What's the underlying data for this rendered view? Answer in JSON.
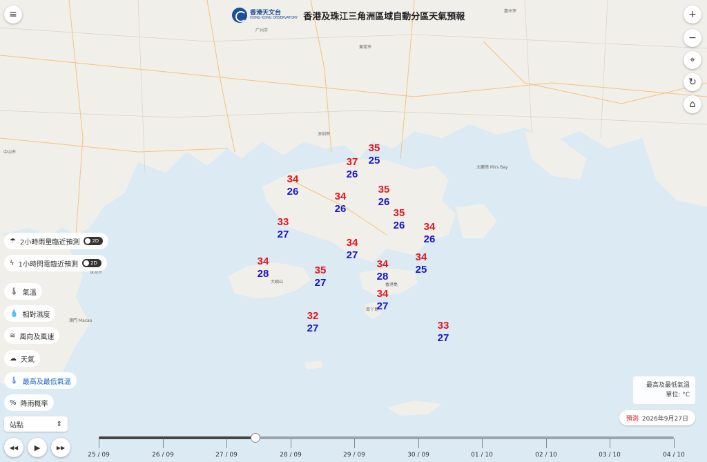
{
  "header": {
    "logo_cn": "香港天文台",
    "logo_en": "HONG KONG OBSERVATORY",
    "title": "香港及珠江三角洲區域自動分區天氣預報"
  },
  "controls": {
    "menu_icon": "≡",
    "zoom_in": "+",
    "zoom_out": "−",
    "locate_icon": "⌖",
    "refresh_icon": "↻",
    "home_icon": "⌂"
  },
  "layers": [
    {
      "label": "2小時雨量臨近預測",
      "icon": "☂",
      "toggle": "2D"
    },
    {
      "label": "1小時閃電臨近預測",
      "icon": "ϟ",
      "toggle": "2D"
    },
    {
      "label": "氣溫",
      "icon": "🌡"
    },
    {
      "label": "相對濕度",
      "icon": "💧"
    },
    {
      "label": "風向及風速",
      "icon": "≋"
    },
    {
      "label": "天氣",
      "icon": "☁"
    },
    {
      "label": "最高及最低氣溫",
      "icon": "🌡",
      "active": true
    },
    {
      "label": "降雨概率",
      "icon": "%"
    }
  ],
  "station_select": {
    "value": "站點",
    "arrow": "⇕"
  },
  "playback": {
    "prev": "◀◀",
    "play": "▶",
    "next": "▶▶"
  },
  "legend": {
    "line1": "最高及最低氣溫",
    "line2": "單位: °C"
  },
  "forecast": {
    "label": "預測",
    "date": "2026年9月27日"
  },
  "timeline": {
    "dates": [
      "25 / 09",
      "26 / 09",
      "27 / 09",
      "28 / 09",
      "29 / 09",
      "30 / 09",
      "01 / 10",
      "02 / 10",
      "03 / 10",
      "04 / 10"
    ],
    "current_index": 2
  },
  "temperatures": [
    {
      "max": "35",
      "min": "25"
    },
    {
      "max": "37",
      "min": "26"
    },
    {
      "max": "34",
      "min": "26"
    },
    {
      "max": "34",
      "min": "26"
    },
    {
      "max": "35",
      "min": "26"
    },
    {
      "max": "35",
      "min": "26"
    },
    {
      "max": "33",
      "min": "27"
    },
    {
      "max": "34",
      "min": "26"
    },
    {
      "max": "34",
      "min": "27"
    },
    {
      "max": "34",
      "min": "28"
    },
    {
      "max": "35",
      "min": "27"
    },
    {
      "max": "34",
      "min": "28"
    },
    {
      "max": "34",
      "min": "25"
    },
    {
      "max": "34",
      "min": "27"
    },
    {
      "max": "32",
      "min": "27"
    },
    {
      "max": "33",
      "min": "27"
    }
  ],
  "map_labels": {
    "shenzhen": "深圳市",
    "dongguan": "東莞市",
    "guangzhou": "广州市",
    "huizhou": "惠州市",
    "zhuhai": "珠海市",
    "macao": "澳門 Macao",
    "zhongshan": "中山市",
    "mirs_bay": "大鵬灣 Mirs Bay",
    "lantau": "大嶼山",
    "hong_kong_island": "香港島",
    "lamma": "南丫島"
  }
}
